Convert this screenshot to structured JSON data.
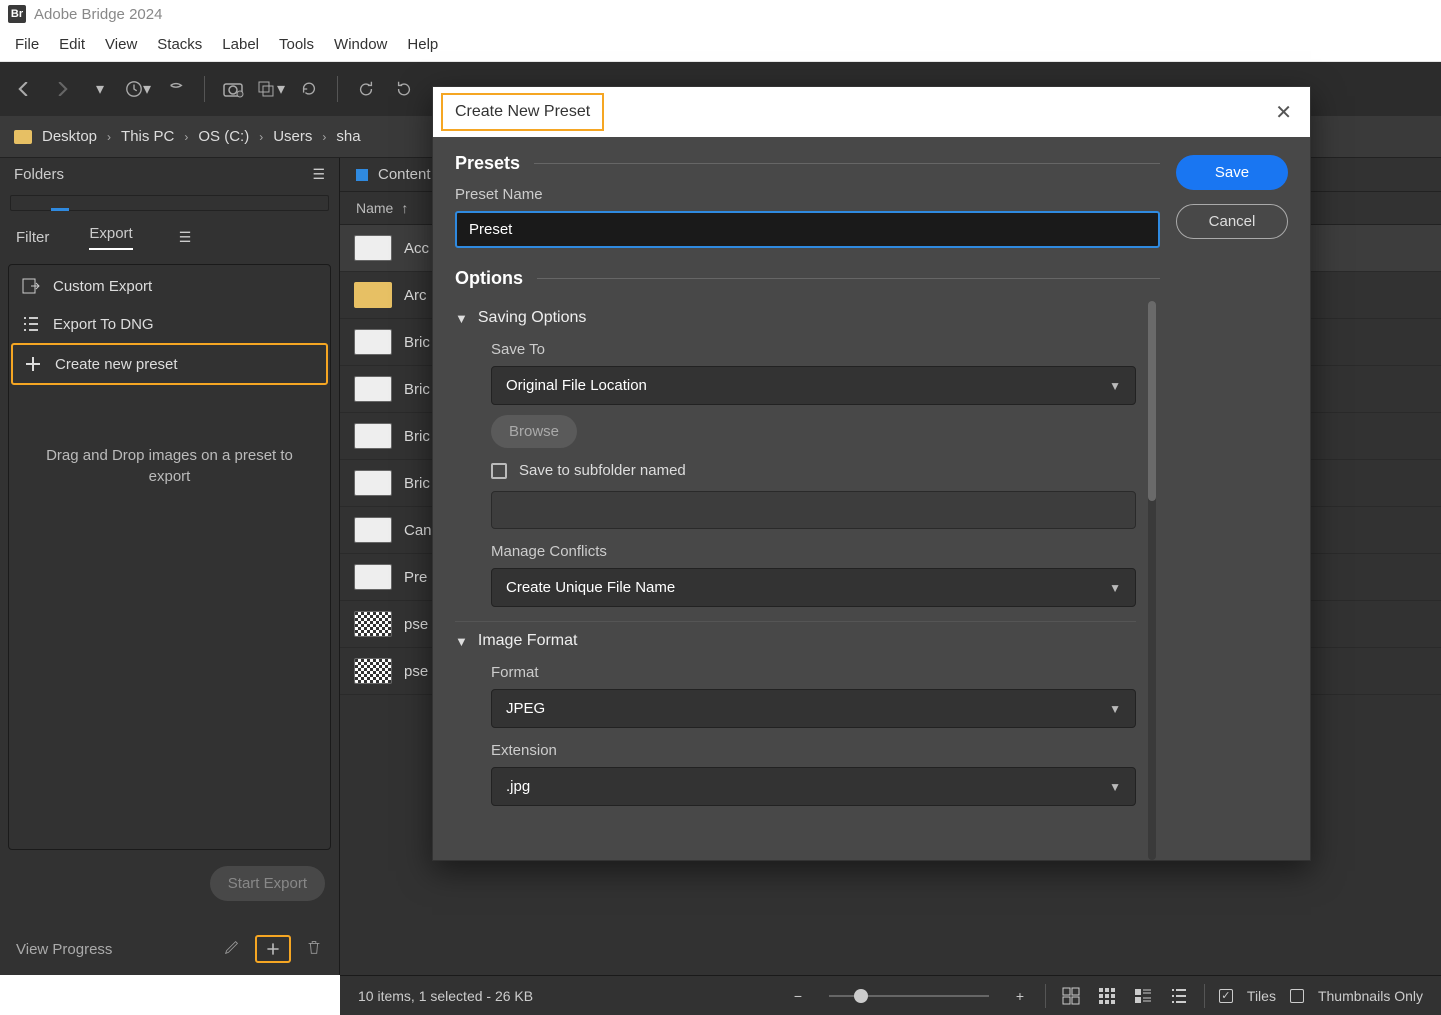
{
  "app": {
    "title": "Adobe Bridge 2024",
    "icon_label": "Br"
  },
  "menubar": {
    "items": [
      "File",
      "Edit",
      "View",
      "Stacks",
      "Label",
      "Tools",
      "Window",
      "Help"
    ]
  },
  "breadcrumb": {
    "items": [
      "Desktop",
      "This PC",
      "OS (C:)",
      "Users",
      "sha"
    ]
  },
  "left": {
    "folders_label": "Folders",
    "filter_label": "Filter",
    "export_label": "Export",
    "rows": [
      {
        "label": "Custom Export"
      },
      {
        "label": "Export To DNG"
      },
      {
        "label": "Create new preset",
        "highlight": true
      }
    ],
    "drop_hint": "Drag and Drop images on a preset to export",
    "start_export": "Start Export",
    "view_progress": "View Progress"
  },
  "content": {
    "tab_label": "Content",
    "column_name": "Name",
    "files": [
      {
        "name": "Acc",
        "selected": true,
        "thumb": "img"
      },
      {
        "name": "Arc",
        "thumb": "folder"
      },
      {
        "name": "Bric",
        "thumb": "img"
      },
      {
        "name": "Bric",
        "thumb": "img"
      },
      {
        "name": "Bric",
        "thumb": "img"
      },
      {
        "name": "Bric",
        "thumb": "img"
      },
      {
        "name": "Can",
        "thumb": "img"
      },
      {
        "name": "Pre",
        "thumb": "img"
      },
      {
        "name": "pse",
        "thumb": "qr"
      },
      {
        "name": "pse",
        "thumb": "qr"
      }
    ]
  },
  "modal": {
    "title": "Create New Preset",
    "save": "Save",
    "cancel": "Cancel",
    "presets_hdr": "Presets",
    "preset_name_label": "Preset Name",
    "preset_name_value": "Preset",
    "options_hdr": "Options",
    "saving_options_hdr": "Saving Options",
    "save_to_label": "Save To",
    "save_to_value": "Original File Location",
    "browse": "Browse",
    "subfolder_label": "Save to subfolder named",
    "conflicts_label": "Manage Conflicts",
    "conflicts_value": "Create Unique File Name",
    "image_format_hdr": "Image Format",
    "format_label": "Format",
    "format_value": "JPEG",
    "extension_label": "Extension",
    "extension_value": ".jpg"
  },
  "statusbar": {
    "summary": "10 items, 1 selected - 26 KB",
    "tiles_label": "Tiles",
    "thumbnails_label": "Thumbnails Only"
  }
}
